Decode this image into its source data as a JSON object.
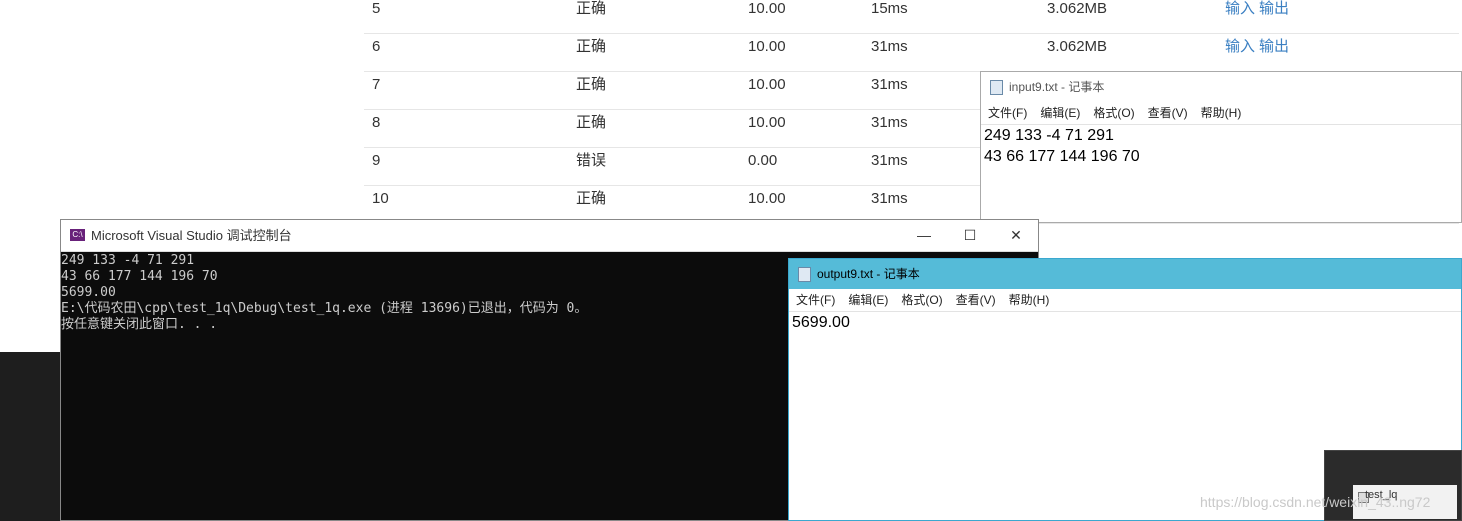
{
  "table": {
    "rows": [
      {
        "num": "5",
        "result": "正确",
        "score": "10.00",
        "time": "15ms",
        "memory": "3.062MB",
        "input": "输入",
        "output": "输出"
      },
      {
        "num": "6",
        "result": "正确",
        "score": "10.00",
        "time": "31ms",
        "memory": "3.062MB",
        "input": "输入",
        "output": "输出"
      },
      {
        "num": "7",
        "result": "正确",
        "score": "10.00",
        "time": "31ms",
        "memory": "",
        "input": "",
        "output": ""
      },
      {
        "num": "8",
        "result": "正确",
        "score": "10.00",
        "time": "31ms",
        "memory": "",
        "input": "",
        "output": ""
      },
      {
        "num": "9",
        "result": "错误",
        "score": "0.00",
        "time": "31ms",
        "memory": "",
        "input": "",
        "output": ""
      },
      {
        "num": "10",
        "result": "正确",
        "score": "10.00",
        "time": "31ms",
        "memory": "",
        "input": "",
        "output": ""
      }
    ]
  },
  "notepad_input": {
    "title": "input9.txt - 记事本",
    "menu": [
      "文件(F)",
      "编辑(E)",
      "格式(O)",
      "查看(V)",
      "帮助(H)"
    ],
    "lines": [
      "249 133 -4 71 291",
      "43 66 177 144 196 70"
    ]
  },
  "notepad_output": {
    "title": "output9.txt - 记事本",
    "menu": [
      "文件(F)",
      "编辑(E)",
      "格式(O)",
      "查看(V)",
      "帮助(H)"
    ],
    "lines": [
      "5699.00"
    ]
  },
  "console": {
    "title": "Microsoft Visual Studio 调试控制台",
    "icon_text": "C:\\",
    "minimize": "—",
    "maximize": "☐",
    "close": "✕",
    "lines": [
      "249 133 -4 71 291",
      "43 66 177 144 196 70",
      "5699.00",
      "E:\\代码农田\\cpp\\test_1q\\Debug\\test_1q.exe (进程 13696)已退出，代码为 0。",
      "按任意键关闭此窗口. . ."
    ]
  },
  "taskbar_thumb": {
    "label": "test_lq"
  },
  "watermark": "https://blog.csdn.net/weixin_43..ng72"
}
